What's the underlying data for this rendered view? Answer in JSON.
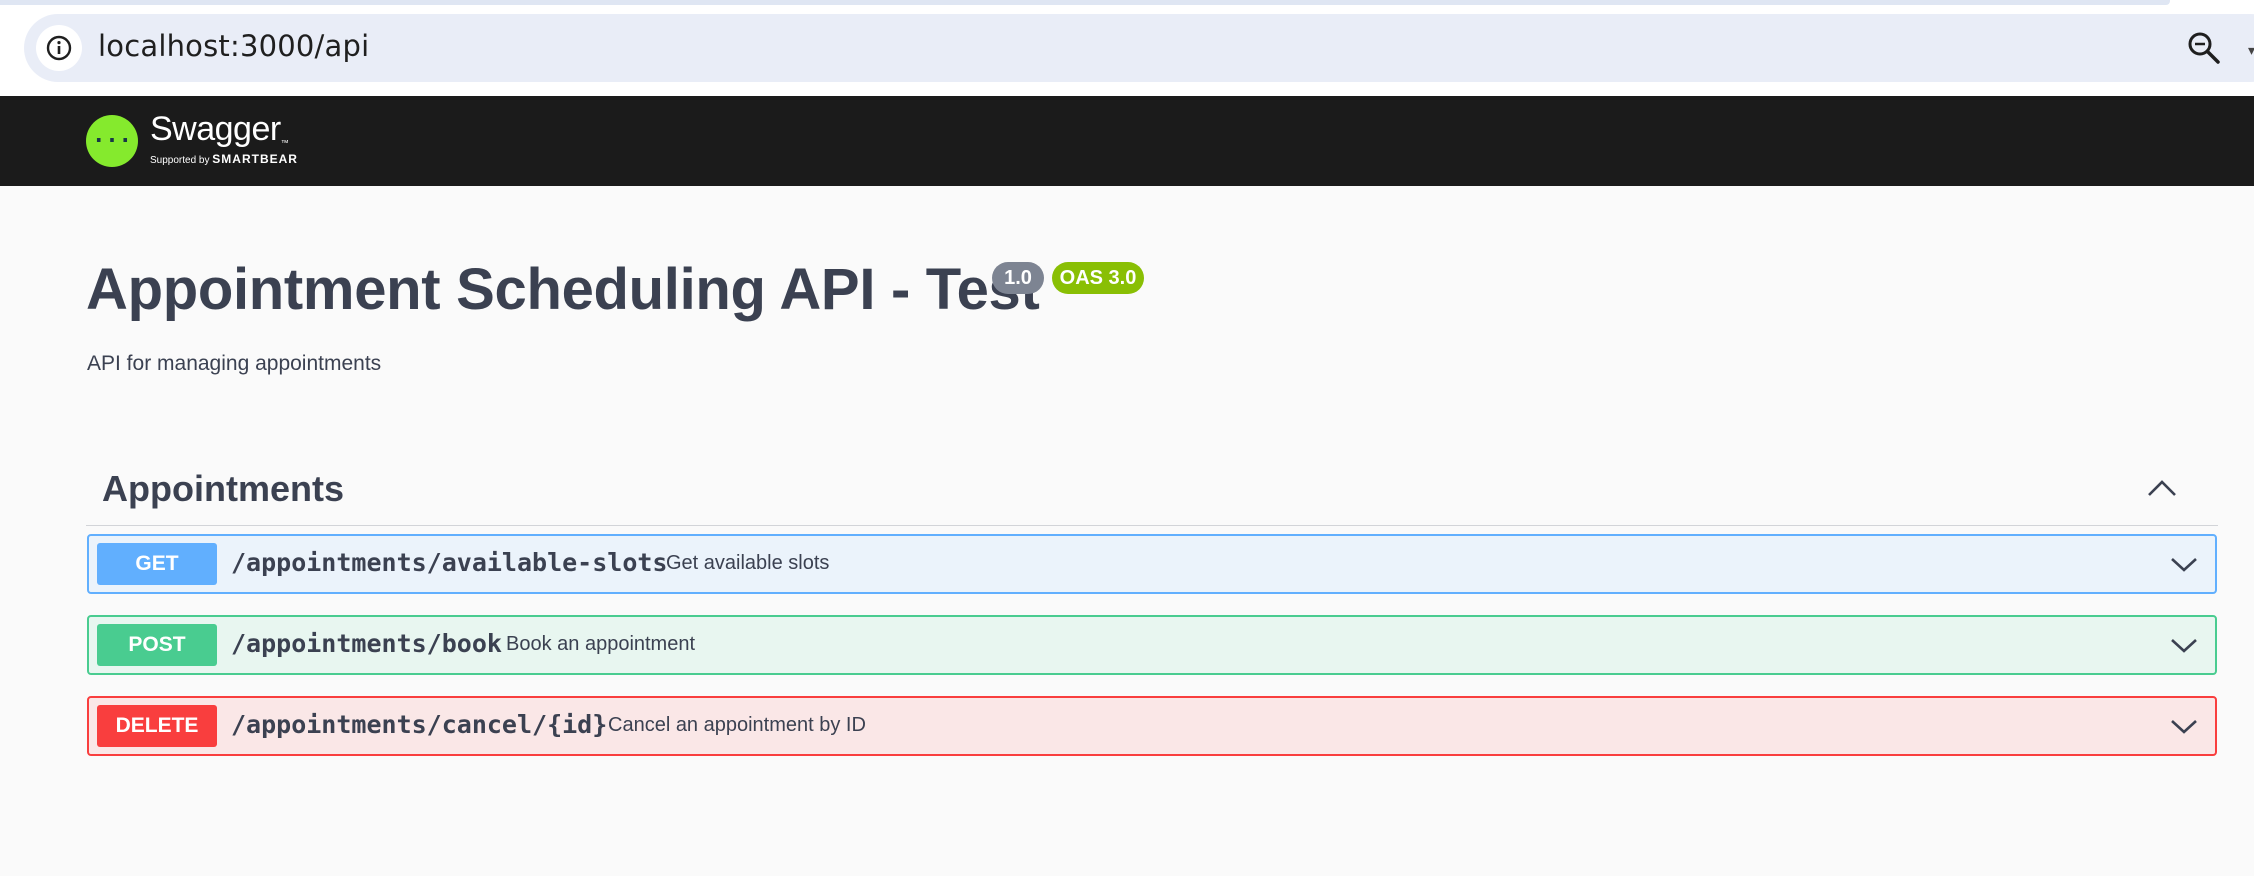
{
  "browser": {
    "url": "localhost:3000/api"
  },
  "swagger_logo": {
    "title": "Swagger",
    "subtitle": "Supported by",
    "brand": "SMARTBEAR"
  },
  "info": {
    "title": "Appointment Scheduling API - Test",
    "version": "1.0",
    "oas_version": "OAS 3.0",
    "description": "API for managing appointments"
  },
  "tag": {
    "name": "Appointments"
  },
  "operations": [
    {
      "method": "GET",
      "path": "/appointments/available-slots",
      "summary": "Get available slots",
      "color": "#61affe"
    },
    {
      "method": "POST",
      "path": "/appointments/book",
      "summary": "Book an appointment",
      "color": "#49cc90"
    },
    {
      "method": "DELETE",
      "path": "/appointments/cancel/{id}",
      "summary": "Cancel an appointment by ID",
      "color": "#f93e3e"
    }
  ],
  "icons": {
    "site_info": "info-icon",
    "zoom": "zoom-icon",
    "collapse": "chevron-up-icon",
    "expand": "chevron-down-icon",
    "logo": "swagger-logo-icon"
  },
  "colors": {
    "topbar": "#1b1b1b",
    "logo_green": "#85ea2d",
    "text": "#3b4151"
  }
}
